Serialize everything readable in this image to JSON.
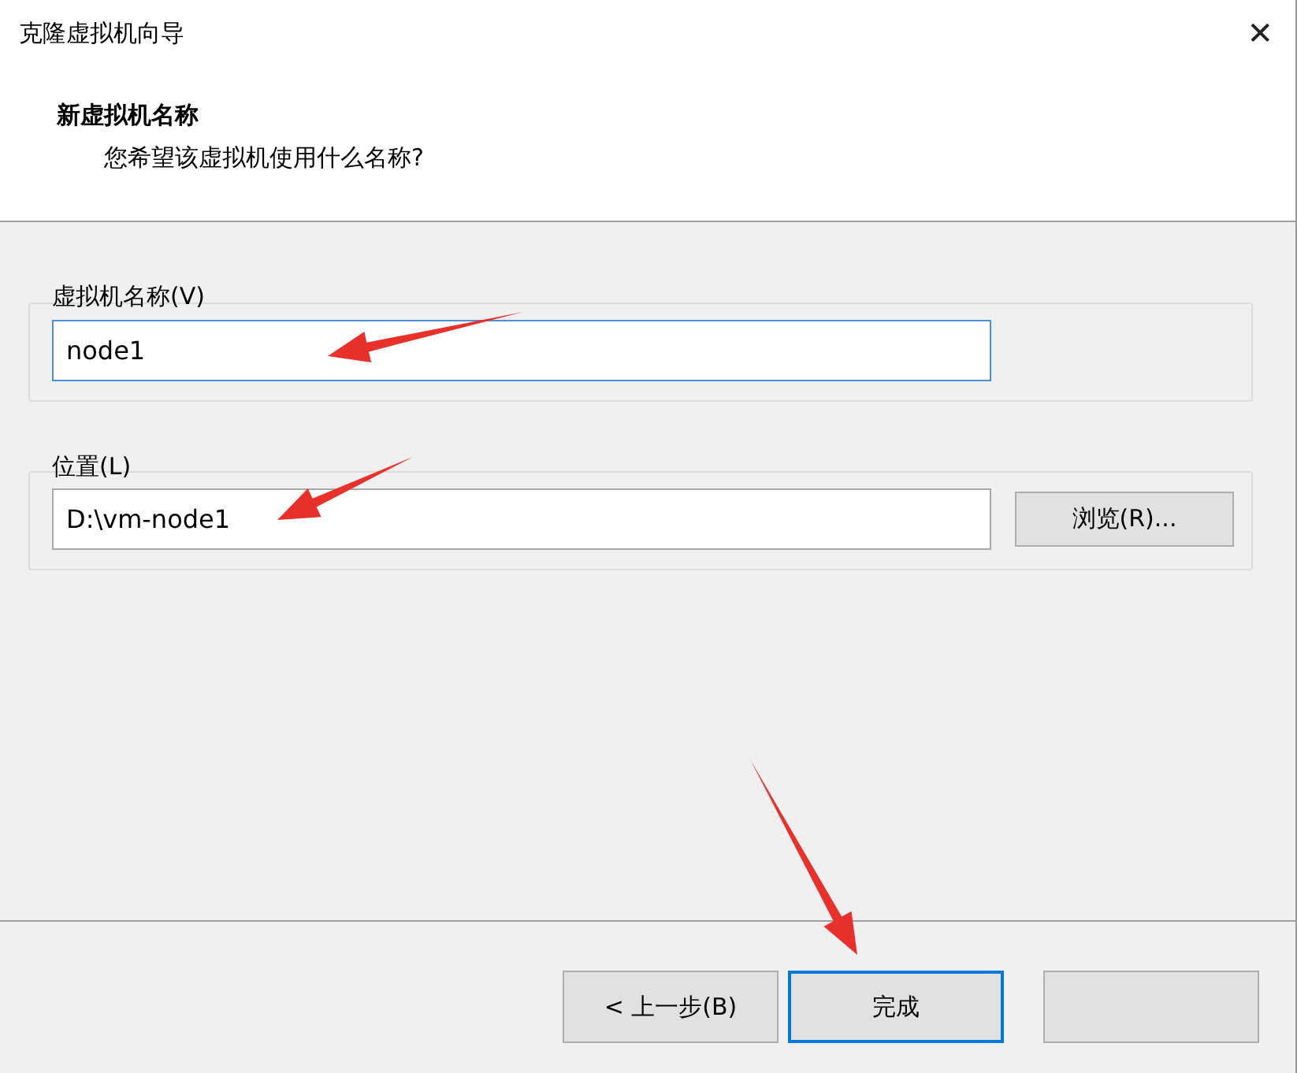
{
  "window": {
    "title": "克隆虚拟机向导",
    "close": "✕"
  },
  "header": {
    "title": "新虚拟机名称",
    "subtitle": "您希望该虚拟机使用什么名称?"
  },
  "name_group": {
    "label": "虚拟机名称(V)",
    "value": "node1",
    "focused": true
  },
  "location_group": {
    "label": "位置(L)",
    "value": "D:\\vm-node1",
    "browse": "浏览(R)..."
  },
  "buttons": [
    {
      "label": "< 上一步(B)",
      "default": false
    },
    {
      "label": "完成",
      "default": true
    },
    {
      "default": false
    }
  ]
}
